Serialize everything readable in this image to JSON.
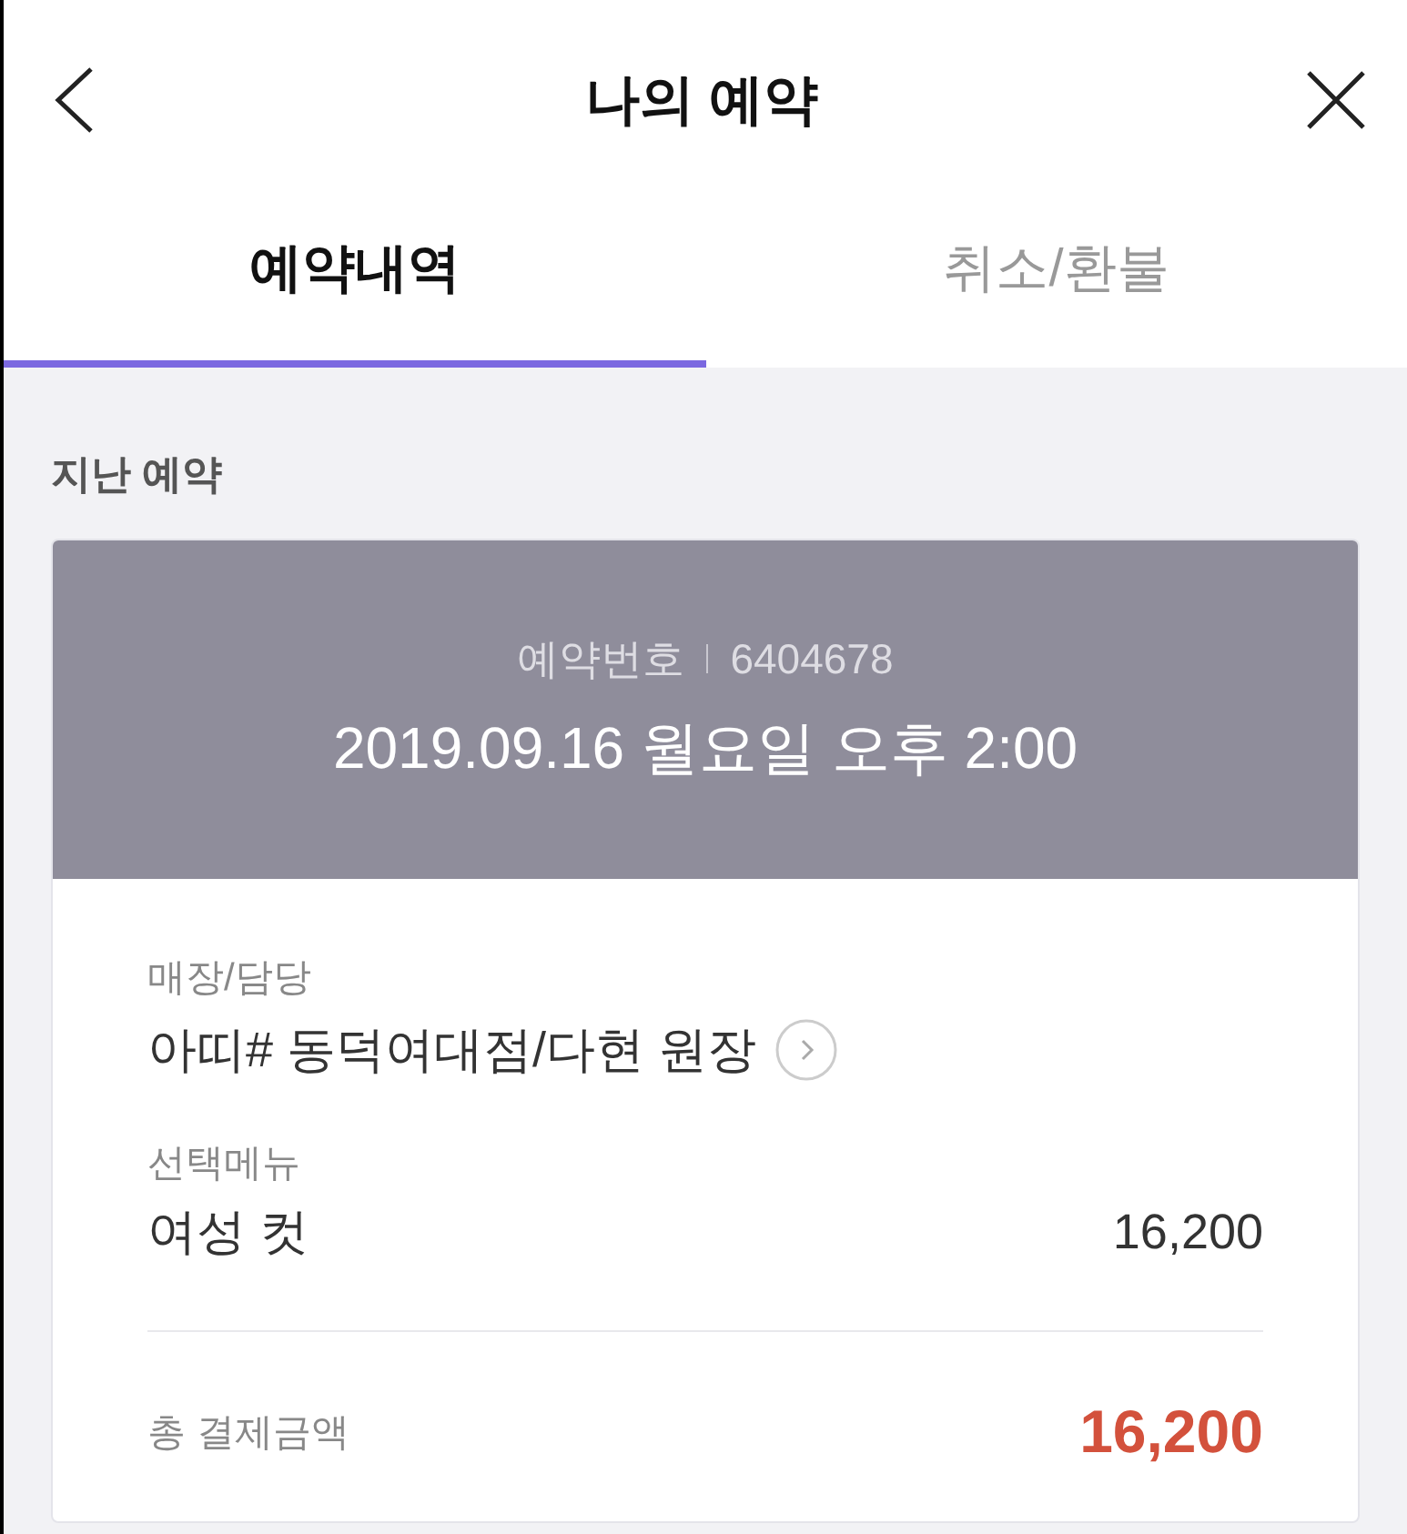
{
  "header": {
    "title": "나의 예약"
  },
  "tabs": [
    {
      "label": "예약내역",
      "selected": true
    },
    {
      "label": "취소/환불",
      "selected": false
    }
  ],
  "section_title": "지난 예약",
  "booking": {
    "number_label": "예약번호",
    "number": "6404678",
    "datetime": "2019.09.16 월요일 오후 2:00",
    "store_label": "매장/담당",
    "store": "아띠# 동덕여대점/다현 원장",
    "menu_label": "선택메뉴",
    "menu_items": [
      {
        "name": "여성 컷",
        "price": "16,200"
      }
    ],
    "total_label": "총 결제금액",
    "total": "16,200"
  }
}
